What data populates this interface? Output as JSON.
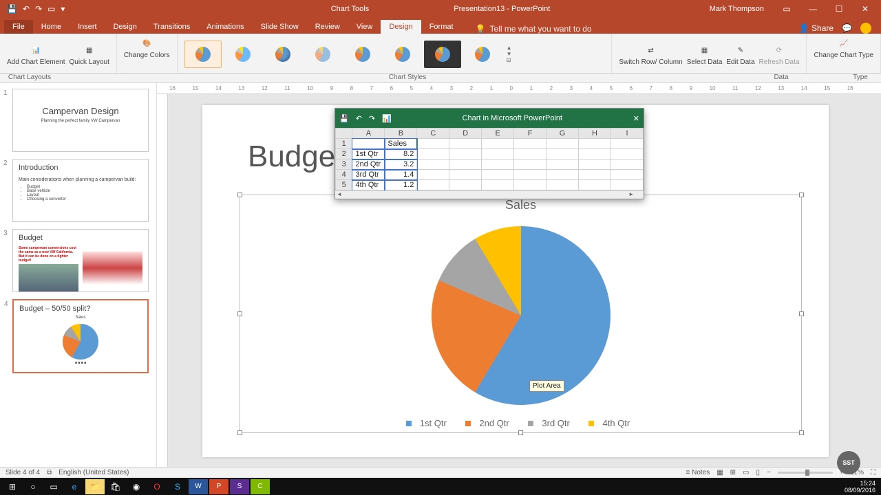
{
  "app": {
    "chart_tools": "Chart Tools",
    "title": "Presentation13 - PowerPoint",
    "user": "Mark Thompson"
  },
  "tabs": {
    "file": "File",
    "home": "Home",
    "insert": "Insert",
    "design_main": "Design",
    "transitions": "Transitions",
    "animations": "Animations",
    "slideshow": "Slide Show",
    "review": "Review",
    "view": "View",
    "design": "Design",
    "format": "Format",
    "tellme": "Tell me what you want to do",
    "share": "Share"
  },
  "ribbon": {
    "add_element": "Add Chart\nElement",
    "quick_layout": "Quick\nLayout",
    "change_colors": "Change\nColors",
    "switch": "Switch Row/\nColumn",
    "select_data": "Select\nData",
    "edit_data": "Edit\nData",
    "refresh": "Refresh\nData",
    "change_type": "Change\nChart Type",
    "group_layouts": "Chart Layouts",
    "group_styles": "Chart Styles",
    "group_data": "Data",
    "group_type": "Type"
  },
  "slide": {
    "title": "Budget – 50/50 split?",
    "chart_title": "Sales",
    "legend": {
      "q1": "1st Qtr",
      "q2": "2nd Qtr",
      "q3": "3rd Qtr",
      "q4": "4th Qtr"
    },
    "tooltip": "Plot Area"
  },
  "thumbs": [
    {
      "title": "Campervan Design",
      "sub": "Planning the perfect family VW Campervan"
    },
    {
      "title": "Introduction",
      "sub": "Main considerations when planning a campervan build:",
      "bullets": [
        "Budget",
        "Base vehicle",
        "Layout",
        "Choosing a converter"
      ]
    },
    {
      "title": "Budget",
      "sub": "Some campervan conversions cost the same as a new VW California.   But it can be done on a tighter budget!"
    },
    {
      "title": "Budget – 50/50 split?"
    }
  ],
  "datasheet": {
    "title": "Chart in Microsoft PowerPoint",
    "cols": [
      "A",
      "B",
      "C",
      "D",
      "E",
      "F",
      "G",
      "H",
      "I"
    ],
    "header": "Sales",
    "rows": [
      {
        "n": "2",
        "label": "1st Qtr",
        "val": "8.2"
      },
      {
        "n": "3",
        "label": "2nd Qtr",
        "val": "3.2"
      },
      {
        "n": "4",
        "label": "3rd Qtr",
        "val": "1.4"
      },
      {
        "n": "5",
        "label": "4th Qtr",
        "val": "1.2"
      }
    ]
  },
  "status": {
    "slide": "Slide 4 of 4",
    "lang": "English (United States)",
    "notes": "Notes",
    "zoom": "11%"
  },
  "taskbar": {
    "time": "15:24",
    "date": "08/09/2016"
  },
  "chart_data": {
    "type": "pie",
    "title": "Sales",
    "categories": [
      "1st Qtr",
      "2nd Qtr",
      "3rd Qtr",
      "4th Qtr"
    ],
    "values": [
      8.2,
      3.2,
      1.4,
      1.2
    ],
    "colors": [
      "#5b9bd5",
      "#ed7d31",
      "#a5a5a5",
      "#ffc000"
    ],
    "legend_position": "bottom"
  },
  "ruler": [
    "16",
    "15",
    "14",
    "13",
    "12",
    "11",
    "10",
    "9",
    "8",
    "7",
    "6",
    "5",
    "4",
    "3",
    "2",
    "1",
    "0",
    "1",
    "2",
    "3",
    "4",
    "5",
    "6",
    "7",
    "8",
    "9",
    "10",
    "11",
    "12",
    "13",
    "14",
    "15",
    "16"
  ]
}
